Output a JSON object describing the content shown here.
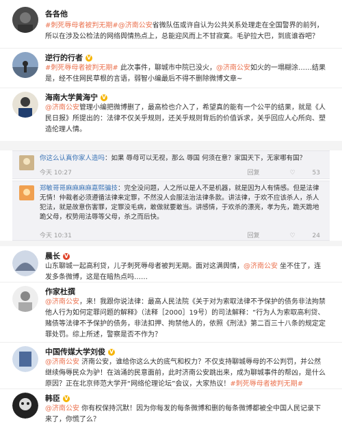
{
  "posts": [
    {
      "name": "各各他",
      "lead": "",
      "tag": "#刺死辱母者被判无期#",
      "mention": "@济南公安",
      "text": "省微队伍或许自认为公共关系处理走在全国警界的前列，所以在涉及公检法的网络舆情热点上，总能迎风而上不甘寂寞。毛驴拉大巴，到底谁吞吧？"
    },
    {
      "name": "逆行的行者",
      "tag": "#刺死辱母者被判无期#",
      "text1": " 此次事件，聊城市中院已没火，",
      "mention": "@济南公安",
      "text2": "如火的一塌糊涂……结果是，经不住网民草根的言语，弱智小编最后不得不删除微博文章~"
    },
    {
      "name": "海南大学黄海宁",
      "mention": "@济南公安",
      "text": "管理小编把微博删了，最高检也介入了，希望真的能有一个公平的结果，就是《人民日报》所提出的：法律不仅关乎规则，还关乎规则背后的价值诉求，关乎回应人心所向、塑造伦理人情。"
    }
  ],
  "cards": [
    {
      "user": "你这么认真你家人造吗",
      "text": "：如果 辱母可以无视，那么 辱国 何须在意？家国天下，无家哪有国？",
      "time": "今天 10:27",
      "share": "回复",
      "likes": "53"
    },
    {
      "user": "郑敏哥哥麻麻麻麻嘉熙骗技",
      "text": "：完全没问题，人之所以是人不是机器，就是因为人有情感。但是法律无情！仲裁者必须遵循法律来定罪，不然没人会服法治法律条款。讲法律，于欢不应该杀人，杀人犯法，就是故意伤害罪，定罪没毛病，敢做就要敢当。讲感情，于欢杀的漂亮，孝为先，跪天跪地跪父母，权势用法辱等父母，杀之而后快。",
      "time": "今天 10:31",
      "share": "回复",
      "likes": "24"
    }
  ],
  "posts2": [
    {
      "name": "晨长",
      "text1": "山东聊城一起高利贷，儿子刺死辱母者被判无期。面对这满舆情，",
      "mention": "@济南公安",
      "text2": " 坐不住了，连发多条微博，这是在暗热点吗……"
    },
    {
      "name": "作家杜撰",
      "mention": "@济南公安",
      "text": "，来！我跟你说法律：最高人民法院《关于对为索取法律不予保护的债务非法拘禁他人行为如何定罪问题的解释》（法释［2000］19号）的司法解释：“行为人为索取高利贷、赌债等法律不予保护的债务，非法扣押、拘禁他人的，依照《刑法》第二百三十八条的规定定罪处罚。综上所述，警察是否不作为？"
    },
    {
      "name": "中国传媒大学刘俊",
      "mention": "@济南公安",
      "text1": " 济南公安，谁给你这么大的底气和权力？不仅支持聊城辱母的不公判罚，并公然继续侮辱民众为驴！在汹涌的民意面前，此时济南公安跳出来，成为聊城事件的帮凶，是什么原因？正在北京师范大学开“网络伦理论坛”会议，大家热议！",
      "tag": "#刺死辱母者被判无期#"
    },
    {
      "name": "韩臣",
      "mention": "@济南公安",
      "text": " 你有权保持沉默！因为你每发的每条微博和删的每条微博都被全中国人民记录下来了，你慌了么？"
    }
  ],
  "icons": {
    "reply": "reply-icon",
    "like": "like-icon"
  }
}
